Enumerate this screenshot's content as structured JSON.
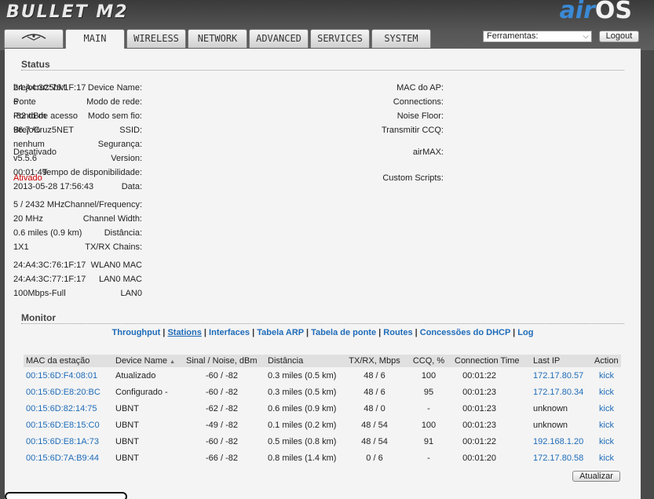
{
  "header": {
    "brand": "BULLET M2",
    "airos_air": "air",
    "airos_os": "OS",
    "tabs": [
      {
        "label": "",
        "icon": "ubnt-logo-icon"
      },
      {
        "label": "MAIN"
      },
      {
        "label": "WIRELESS"
      },
      {
        "label": "NETWORK"
      },
      {
        "label": "ADVANCED"
      },
      {
        "label": "SERVICES"
      },
      {
        "label": "SYSTEM"
      }
    ],
    "tools_select": "Ferramentas:",
    "logout": "Logout"
  },
  "status": {
    "title": "Status",
    "left": [
      {
        "k": "Device Name:",
        "v": "brejocruz5bM"
      },
      {
        "k": "Modo de rede:",
        "v": "Ponte"
      },
      {
        "k": "Modo sem fio:",
        "v": "Ponto de acesso"
      },
      {
        "k": "SSID:",
        "v": "BrejoCruz5NET"
      },
      {
        "k": "Segurança:",
        "v": "nenhum"
      },
      {
        "k": "Version:",
        "v": "v5.5.6"
      },
      {
        "k": "Tempo de disponibilidade:",
        "v": "00:01:49"
      },
      {
        "k": "Data:",
        "v": "2013-05-28 17:56:43"
      },
      {
        "k": "Channel/Frequency:",
        "v": "5 / 2432 MHz"
      },
      {
        "k": "Channel Width:",
        "v": "20 MHz"
      },
      {
        "k": "Distância:",
        "v": "0.6 miles (0.9 km)"
      },
      {
        "k": "TX/RX Chains:",
        "v": "1X1"
      },
      {
        "k": "WLAN0 MAC",
        "v": "24:A4:3C:76:1F:17"
      },
      {
        "k": "LAN0 MAC",
        "v": "24:A4:3C:77:1F:17"
      },
      {
        "k": "LAN0",
        "v": "100Mbps-Full"
      }
    ],
    "right": [
      {
        "k": "MAC do AP:",
        "v": "24:A4:3C:76:1F:17"
      },
      {
        "k": "Connections:",
        "v": "6"
      },
      {
        "k": "Noise Floor:",
        "v": "-82 dBm"
      },
      {
        "k": "Transmitir CCQ:",
        "v": "96.7 %"
      },
      {
        "k": "airMAX:",
        "v": "Desativado"
      },
      {
        "k": "Custom Scripts:",
        "v": "Ativado"
      }
    ]
  },
  "monitor": {
    "title": "Monitor",
    "links": [
      "Throughput",
      "Stations",
      "Interfaces",
      "Tabela ARP",
      "Tabela de ponte",
      "Routes",
      "Concessões do DHCP",
      "Log"
    ],
    "columns": [
      "MAC da estação",
      "Device Name",
      "Sinal / Noise, dBm",
      "Distância",
      "TX/RX, Mbps",
      "CCQ, %",
      "Connection Time",
      "Last IP",
      "Action"
    ],
    "sort_indicator": "▲",
    "rows": [
      [
        "00:15:6D:F4:08:01",
        "Atualizado",
        "-60 / -82",
        "0.3 miles (0.5 km)",
        "48 / 6",
        "100",
        "00:01:22",
        "172.17.80.57",
        "kick"
      ],
      [
        "00:15:6D:E8:20:BC",
        "Configurado -",
        "-60 / -82",
        "0.3 miles (0.5 km)",
        "48 / 6",
        "95",
        "00:01:23",
        "172.17.80.34",
        "kick"
      ],
      [
        "00:15:6D:82:14:75",
        "UBNT",
        "-62 / -82",
        "0.6 miles (0.9 km)",
        "48 / 0",
        "-",
        "00:01:23",
        "unknown",
        "kick"
      ],
      [
        "00:15:6D:E8:15:C0",
        "UBNT",
        "-49 / -82",
        "0.1 miles (0.2 km)",
        "48 / 54",
        "100",
        "00:01:23",
        "unknown",
        "kick"
      ],
      [
        "00:15:6D:E8:1A:73",
        "UBNT",
        "-60 / -82",
        "0.5 miles (0.8 km)",
        "48 / 54",
        "91",
        "00:01:22",
        "192.168.1.20",
        "kick"
      ],
      [
        "00:15:6D:7A:B9:44",
        "UBNT",
        "-66 / -82",
        "0.8 miles (1.4 km)",
        "0 / 6",
        "-",
        "00:01:20",
        "172.17.80.58",
        "kick"
      ]
    ],
    "refresh": "Atualizar"
  },
  "colors": {
    "link": "#1e6bb8",
    "alert": "#d00000",
    "accent": "#3a8ad6"
  }
}
